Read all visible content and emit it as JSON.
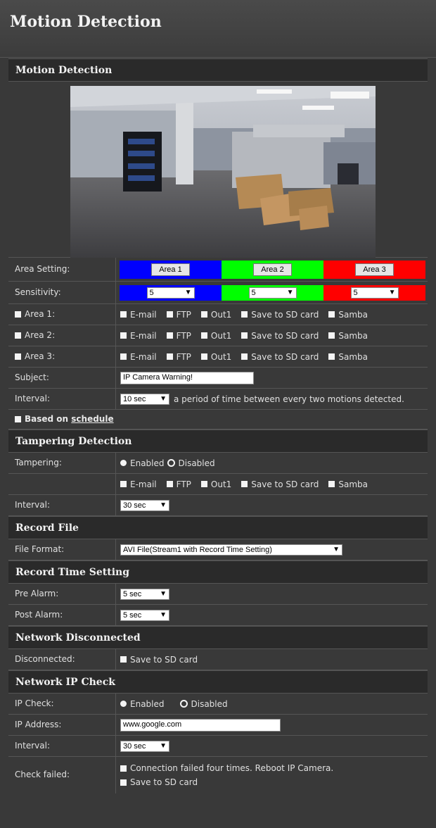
{
  "page": {
    "title": "Motion Detection"
  },
  "motion": {
    "section_title": "Motion Detection",
    "area_setting_label": "Area Setting:",
    "area_buttons": [
      "Area 1",
      "Area 2",
      "Area 3"
    ],
    "sensitivity_label": "Sensitivity:",
    "sensitivity_values": [
      "5",
      "5",
      "5"
    ],
    "area1_label": "Area 1:",
    "area2_label": "Area 2:",
    "area3_label": "Area 3:",
    "actions": [
      "E-mail",
      "FTP",
      "Out1",
      "Save to SD card",
      "Samba"
    ],
    "subject_label": "Subject:",
    "subject_value": "IP Camera Warning!",
    "interval_label": "Interval:",
    "interval_value": "10 sec",
    "interval_desc": "a period of time between every two motions detected.",
    "based_on": "Based on",
    "schedule_link": "schedule"
  },
  "tampering": {
    "section_title": "Tampering Detection",
    "label": "Tampering:",
    "enabled": "Enabled",
    "disabled": "Disabled",
    "interval_label": "Interval:",
    "interval_value": "30 sec"
  },
  "record_file": {
    "section_title": "Record File",
    "format_label": "File Format:",
    "format_value": "AVI File(Stream1 with Record Time Setting)"
  },
  "record_time": {
    "section_title": "Record Time Setting",
    "pre_label": "Pre Alarm:",
    "pre_value": "5 sec",
    "post_label": "Post Alarm:",
    "post_value": "5 sec"
  },
  "network_disconnected": {
    "section_title": "Network Disconnected",
    "label": "Disconnected:",
    "option": "Save to SD card"
  },
  "network_ip_check": {
    "section_title": "Network IP Check",
    "ip_check_label": "IP Check:",
    "enabled": "Enabled",
    "disabled": "Disabled",
    "ip_label": "IP Address:",
    "ip_value": "www.google.com",
    "interval_label": "Interval:",
    "interval_value": "30 sec",
    "check_failed_label": "Check failed:",
    "reboot_option": "Connection failed four times. Reboot IP Camera.",
    "sd_option": "Save to SD card"
  },
  "colors": {
    "area1": "#0000ff",
    "area2": "#00ff00",
    "area3": "#ff0000",
    "background": "#393939",
    "section_header": "#2a2a2a"
  }
}
